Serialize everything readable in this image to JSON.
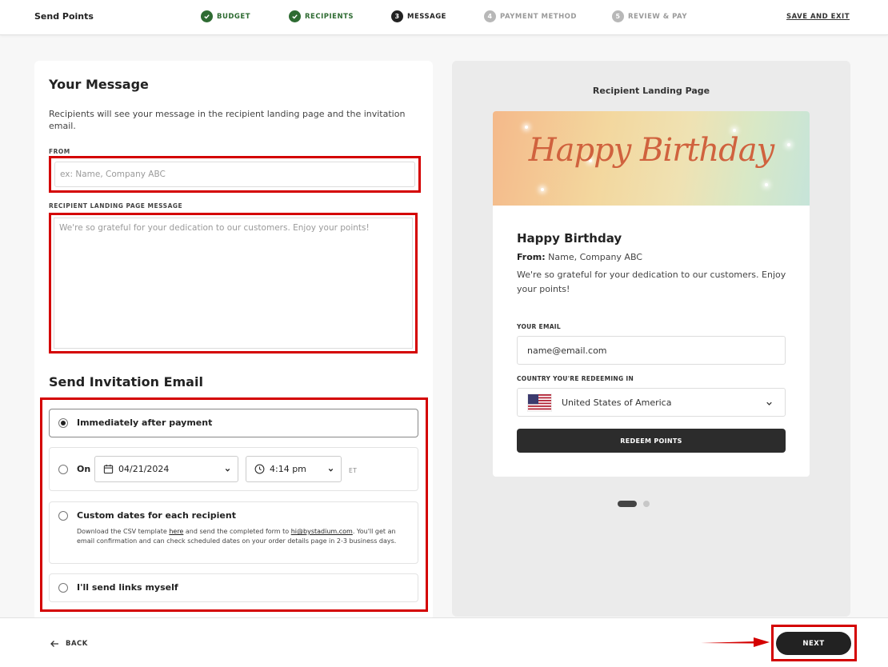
{
  "header": {
    "app_title": "Send Points",
    "steps": [
      {
        "number": "1",
        "label": "BUDGET",
        "state": "done"
      },
      {
        "number": "2",
        "label": "RECIPIENTS",
        "state": "done"
      },
      {
        "number": "3",
        "label": "MESSAGE",
        "state": "current"
      },
      {
        "number": "4",
        "label": "PAYMENT METHOD",
        "state": "todo"
      },
      {
        "number": "5",
        "label": "REVIEW & PAY",
        "state": "todo"
      }
    ],
    "save_exit": "SAVE AND EXIT"
  },
  "message_form": {
    "title": "Your Message",
    "description": "Recipients will see your message in the recipient landing page and the invitation email.",
    "from_label": "FROM",
    "from_placeholder": "ex: Name, Company ABC",
    "landing_label": "RECIPIENT LANDING PAGE MESSAGE",
    "landing_placeholder": "We're so grateful for your dedication to our customers. Enjoy your points!"
  },
  "invitation": {
    "title": "Send Invitation Email",
    "options": {
      "immediate": "Immediately after payment",
      "on": "On",
      "custom": "Custom dates for each recipient",
      "self": "I'll send links myself"
    },
    "selected": "immediate",
    "date_value": "04/21/2024",
    "time_value": "4:14 pm",
    "timezone": "ET",
    "custom_help": {
      "part1": "Download the CSV template ",
      "link1": "here",
      "part2": " and send the completed form to ",
      "link2": "hi@bystadium.com",
      "part3": ". You'll get an email confirmation and can check scheduled dates on your order details page in 2-3 business days."
    }
  },
  "preview": {
    "title": "Recipient Landing Page",
    "banner_text": "Happy Birthday",
    "heading": "Happy Birthday",
    "from_label": "From:",
    "from_value": "Name, Company ABC",
    "message": "We're so grateful for your dedication to our customers. Enjoy your points!",
    "email_label": "YOUR EMAIL",
    "email_placeholder": "name@email.com",
    "country_label": "COUNTRY YOU'RE REDEEMING IN",
    "country_value": "United States of America",
    "redeem_button": "REDEEM POINTS",
    "carousel_index": 1,
    "carousel_count": 2
  },
  "footer": {
    "back": "BACK",
    "next": "NEXT"
  },
  "colors": {
    "done_green": "#2e6b32",
    "highlight_red": "#d40000",
    "dark_button": "#222222",
    "banner_script": "#d0623e"
  }
}
